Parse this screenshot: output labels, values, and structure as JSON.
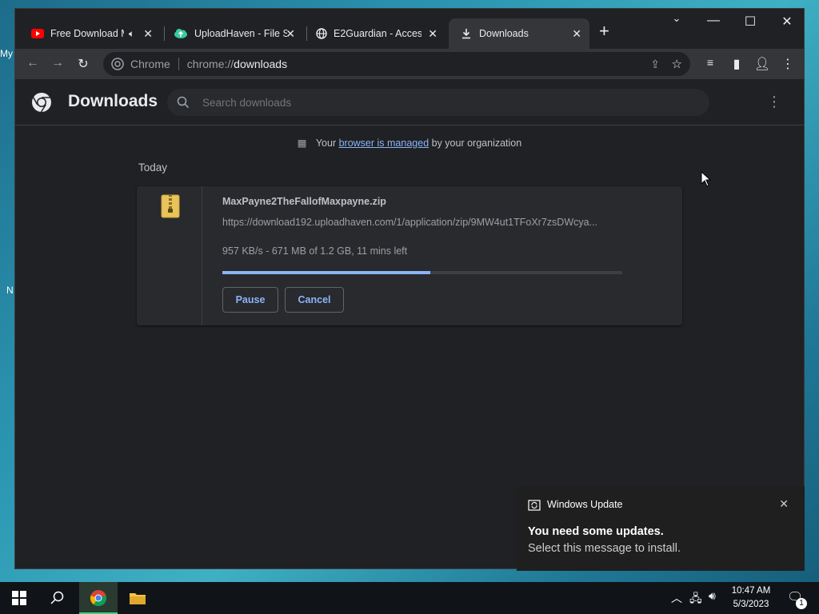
{
  "desktop": {
    "icon_labels": [
      "My",
      "N"
    ]
  },
  "browser": {
    "tabs": [
      {
        "title": "Free Download M",
        "icon": "youtube-icon",
        "audio": true
      },
      {
        "title": "UploadHaven - File Sh",
        "icon": "uploadhaven-icon"
      },
      {
        "title": "E2Guardian - Access",
        "icon": "globe-icon"
      },
      {
        "title": "Downloads",
        "icon": "download-icon",
        "active": true
      }
    ],
    "omnibox": {
      "site_label": "Chrome",
      "url_prefix": "chrome://",
      "url_page": "downloads"
    }
  },
  "downloads_page": {
    "title": "Downloads",
    "search_placeholder": "Search downloads",
    "managed_prefix": "Your ",
    "managed_link": "browser is managed",
    "managed_suffix": " by your organization",
    "section_label": "Today",
    "item": {
      "filename": "MaxPayne2TheFallofMaxpayne.zip",
      "url": "https://download192.uploadhaven.com/1/application/zip/9MW4ut1TFoXr7zsDWcya...",
      "status": "957 KB/s - 671 MB of 1.2 GB, 11 mins left",
      "progress_fraction": 0.52,
      "pause_label": "Pause",
      "cancel_label": "Cancel"
    }
  },
  "notification": {
    "app": "Windows Update",
    "title": "You need some updates.",
    "body": "Select this message to install."
  },
  "taskbar": {
    "time": "10:47 AM",
    "date": "5/3/2023",
    "notification_count": "1"
  },
  "colors": {
    "accent": "#8ab4f8",
    "progress_track": "#3c4043",
    "progress_fill": "#8ab4f8",
    "page_bg": "#202124",
    "card_bg": "#292a2d"
  }
}
